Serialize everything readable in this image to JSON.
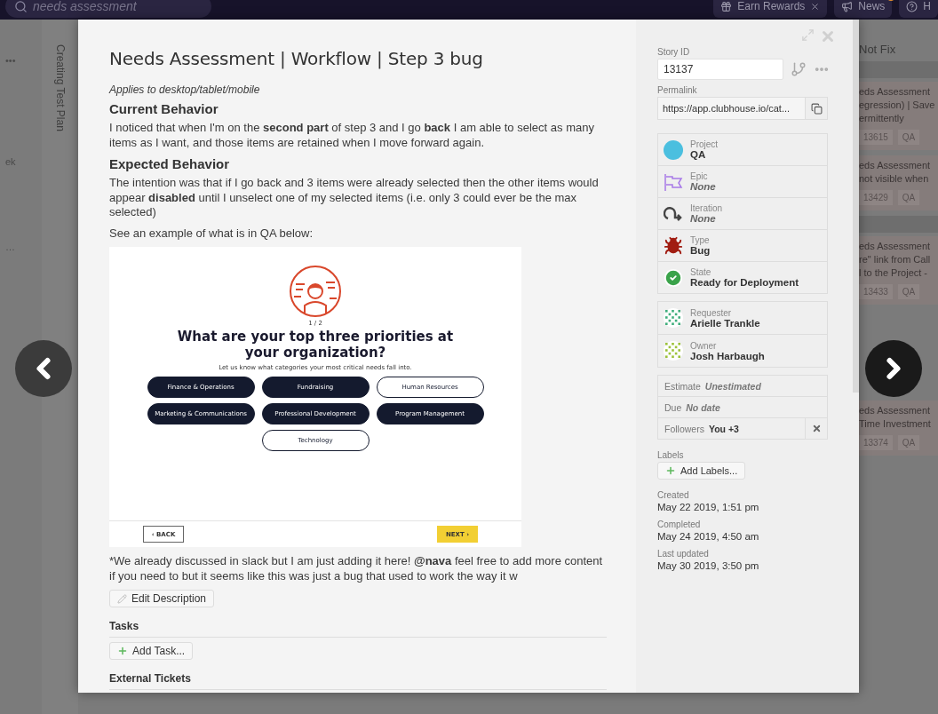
{
  "topbar": {
    "search": {
      "value": "needs assessment"
    },
    "buttons": [
      {
        "kind": "rewards",
        "label": "Earn Rewards",
        "closable": true,
        "badge": false
      },
      {
        "kind": "news",
        "label": "News",
        "closable": false,
        "badge": true
      },
      {
        "kind": "help",
        "label": "H",
        "closable": false,
        "badge": false
      }
    ]
  },
  "board_left": {
    "menu": "•••",
    "columns": [
      "Creating Test Plan"
    ],
    "fragments": [
      "ek",
      "…"
    ]
  },
  "board_right": {
    "heading": "Not Fix",
    "groups": [
      {
        "cards": [
          {
            "lines": [
              "eds Assessment",
              "egression) | Save",
              "ermittently"
            ],
            "id": "13615",
            "tag": "QA"
          },
          {
            "lines": [
              "eds Assessment",
              "not visible when"
            ],
            "id": "13429",
            "tag": "QA"
          }
        ]
      },
      {
        "cards": [
          {
            "lines": [
              "eds Assessment",
              "re\" link from Call",
              "l to the Project -"
            ],
            "id": "13433",
            "tag": "QA"
          },
          {
            "lines": [
              "eds Assessment",
              "Time Investment"
            ],
            "id": "13374",
            "tag": "QA"
          }
        ]
      }
    ]
  },
  "story": {
    "title": "Needs Assessment | Workflow | Step 3 bug",
    "description": [
      {
        "kind": "note",
        "text": "Applies to desktop/tablet/mobile"
      },
      {
        "kind": "heading",
        "text": "Current Behavior"
      },
      {
        "kind": "para",
        "text": "I noticed that when I'm on the **second part** of step 3 and I go **back** I am able to select as many items as I want, and those items are retained when I move forward again."
      },
      {
        "kind": "heading",
        "text": "Expected Behavior"
      },
      {
        "kind": "para",
        "text": "The intention was that if I go back and 3 items were already selected then the other items would appear **disabled** until I unselect one of my selected items (i.e. only 3 could ever be the max selected)"
      },
      {
        "kind": "para",
        "text": "See an example of what is in QA below:"
      },
      {
        "kind": "screenshot"
      },
      {
        "kind": "para",
        "text": "*We already discussed in slack but I am just adding it here! **@nava** feel free to add more content if you need to but it seems like this was just a bug that used to work the way it w"
      }
    ],
    "screenshot": {
      "step": "1 / 2",
      "question": "What are your top three priorities at your organization?",
      "hint": "Let us know what categories your most critical needs fall into.",
      "options": [
        {
          "label": "Finance & Operations",
          "selected": true
        },
        {
          "label": "Fundraising",
          "selected": true
        },
        {
          "label": "Human Resources",
          "selected": false
        },
        {
          "label": "Marketing & Communications",
          "selected": true
        },
        {
          "label": "Professional Development",
          "selected": true
        },
        {
          "label": "Program Management",
          "selected": true
        },
        {
          "label": "Technology",
          "selected": false
        }
      ],
      "back": "‹ BACK",
      "next": "NEXT ›"
    },
    "edit_button": "Edit Description",
    "tasks": {
      "heading": "Tasks",
      "button": "Add Task..."
    },
    "external": {
      "heading": "External Tickets"
    }
  },
  "sidebar": {
    "story_id": {
      "label": "Story ID",
      "value": "13137"
    },
    "permalink": {
      "label": "Permalink",
      "value": "https://app.clubhouse.io/cat..."
    },
    "attributes": [
      {
        "kind": "project",
        "label": "Project",
        "value": "QA",
        "color": "#4bbfdf",
        "empty": false
      },
      {
        "kind": "epic",
        "label": "Epic",
        "value": "None",
        "empty": true
      },
      {
        "kind": "iteration",
        "label": "Iteration",
        "value": "None",
        "empty": true
      },
      {
        "kind": "bug",
        "label": "Type",
        "value": "Bug",
        "empty": false
      },
      {
        "kind": "state",
        "label": "State",
        "value": "Ready for Deployment",
        "empty": false
      }
    ],
    "people": [
      {
        "kind": "requester",
        "label": "Requester",
        "value": "Arielle Trankle"
      },
      {
        "kind": "owner",
        "label": "Owner",
        "value": "Josh Harbaugh"
      }
    ],
    "meta": [
      {
        "label": "Estimate",
        "value": "Unestimated",
        "empty": true,
        "removable": false
      },
      {
        "label": "Due",
        "value": "No date",
        "empty": true,
        "removable": false
      },
      {
        "label": "Followers",
        "value": "You +3",
        "empty": false,
        "removable": true
      }
    ],
    "labels": {
      "label": "Labels",
      "button": "Add Labels..."
    },
    "dates": [
      {
        "label": "Created",
        "value": "May 22 2019, 1:51 pm"
      },
      {
        "label": "Completed",
        "value": "May 24 2019, 4:50 am"
      },
      {
        "label": "Last updated",
        "value": "May 30 2019, 3:50 pm"
      }
    ]
  }
}
